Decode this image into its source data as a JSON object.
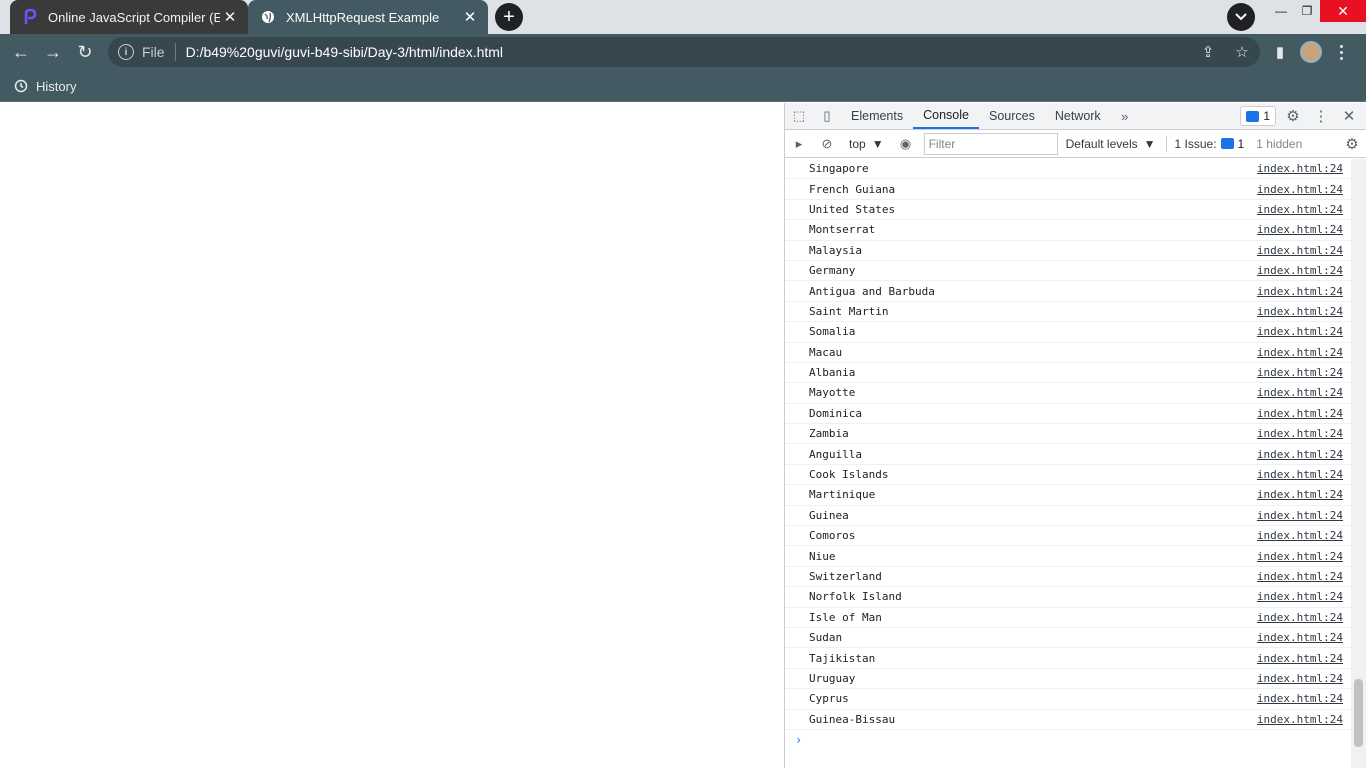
{
  "browser": {
    "tabs": [
      {
        "title": "Online JavaScript Compiler (Editor",
        "favicon": "programiz-icon",
        "active": false
      },
      {
        "title": "XMLHttpRequest Example",
        "favicon": "globe-icon",
        "active": true
      }
    ],
    "new_tab": "+",
    "scheme": "File",
    "url": "D:/b49%20guvi/guvi-b49-sibi/Day-3/html/index.html",
    "bookmark": "History",
    "colors": {
      "toolbar": "#435a63",
      "tabstrip": "#dee1e6",
      "close_red": "#e81123"
    }
  },
  "devtools": {
    "tabs": [
      "Elements",
      "Console",
      "Sources",
      "Network"
    ],
    "active_tab": "Console",
    "message_badge": "1",
    "context": "top",
    "filter_placeholder": "Filter",
    "levels": "Default levels",
    "issues_label": "1 Issue:",
    "issues_count": "1",
    "hidden": "1 hidden",
    "prompt": "›",
    "logs": [
      {
        "msg": "Singapore",
        "src": "index.html:24"
      },
      {
        "msg": "French Guiana",
        "src": "index.html:24"
      },
      {
        "msg": "United States",
        "src": "index.html:24"
      },
      {
        "msg": "Montserrat",
        "src": "index.html:24"
      },
      {
        "msg": "Malaysia",
        "src": "index.html:24"
      },
      {
        "msg": "Germany",
        "src": "index.html:24"
      },
      {
        "msg": "Antigua and Barbuda",
        "src": "index.html:24"
      },
      {
        "msg": "Saint Martin",
        "src": "index.html:24"
      },
      {
        "msg": "Somalia",
        "src": "index.html:24"
      },
      {
        "msg": "Macau",
        "src": "index.html:24"
      },
      {
        "msg": "Albania",
        "src": "index.html:24"
      },
      {
        "msg": "Mayotte",
        "src": "index.html:24"
      },
      {
        "msg": "Dominica",
        "src": "index.html:24"
      },
      {
        "msg": "Zambia",
        "src": "index.html:24"
      },
      {
        "msg": "Anguilla",
        "src": "index.html:24"
      },
      {
        "msg": "Cook Islands",
        "src": "index.html:24"
      },
      {
        "msg": "Martinique",
        "src": "index.html:24"
      },
      {
        "msg": "Guinea",
        "src": "index.html:24"
      },
      {
        "msg": "Comoros",
        "src": "index.html:24"
      },
      {
        "msg": "Niue",
        "src": "index.html:24"
      },
      {
        "msg": "Switzerland",
        "src": "index.html:24"
      },
      {
        "msg": "Norfolk Island",
        "src": "index.html:24"
      },
      {
        "msg": "Isle of Man",
        "src": "index.html:24"
      },
      {
        "msg": "Sudan",
        "src": "index.html:24"
      },
      {
        "msg": "Tajikistan",
        "src": "index.html:24"
      },
      {
        "msg": "Uruguay",
        "src": "index.html:24"
      },
      {
        "msg": "Cyprus",
        "src": "index.html:24"
      },
      {
        "msg": "Guinea-Bissau",
        "src": "index.html:24"
      }
    ]
  }
}
